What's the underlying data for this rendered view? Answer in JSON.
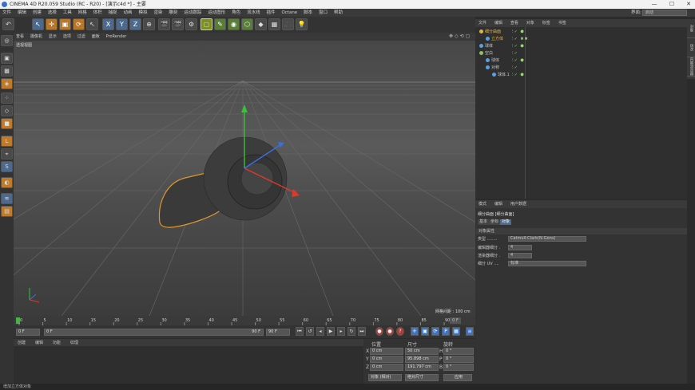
{
  "window": {
    "title": "CINEMA 4D R20.059 Studio (RC - R20) - [演示c4d *] - 主要",
    "min": "—",
    "max": "☐",
    "close": "✕"
  },
  "menubar": {
    "items": [
      "文件",
      "编辑",
      "创建",
      "选择",
      "工具",
      "网格",
      "体积",
      "捕捉",
      "动画",
      "模拟",
      "渲染",
      "雕刻",
      "运动跟踪",
      "运动图形",
      "角色",
      "流水线",
      "插件",
      "Octane",
      "脚本",
      "窗口",
      "帮助"
    ],
    "layout_label": "界面:",
    "layout_value": "启动"
  },
  "viewport": {
    "menu": [
      "查看",
      "摄像机",
      "显示",
      "选项",
      "过滤",
      "面板",
      "ProRender"
    ],
    "label": "透视视图",
    "controls": "✥◇⟲▢",
    "grid_info": "网格间距 : 100 cm"
  },
  "timeline": {
    "ticks": [
      "0",
      "5",
      "10",
      "15",
      "20",
      "25",
      "30",
      "35",
      "40",
      "45",
      "50",
      "55",
      "60",
      "65",
      "70",
      "75",
      "80",
      "85",
      "90"
    ],
    "end_frame": "0 F"
  },
  "transport": {
    "current": "0 F",
    "start": "0 F",
    "range_end": "90 F",
    "end": "90 F"
  },
  "materials": {
    "menu": [
      "创建",
      "编辑",
      "功能",
      "纹理"
    ]
  },
  "coordinates": {
    "headers": [
      "位置",
      "尺寸",
      "旋转"
    ],
    "rows": [
      {
        "axis": "X",
        "pos": "0 cm",
        "size": "50 cm",
        "rot_axis": "H",
        "rot": "0 °"
      },
      {
        "axis": "Y",
        "pos": "0 cm",
        "size": "95.898 cm",
        "rot_axis": "P",
        "rot": "0 °"
      },
      {
        "axis": "Z",
        "pos": "0 cm",
        "size": "191.797 cm",
        "rot_axis": "B",
        "rot": "0 °"
      }
    ],
    "mode1": "对象 (相对)",
    "mode2": "绝对尺寸",
    "apply": "应用"
  },
  "objects": {
    "menu": [
      "文件",
      "编辑",
      "查看",
      "对象",
      "标签",
      "书签"
    ],
    "tree": [
      {
        "label": "细分曲面",
        "indent": 0,
        "color": "#e0b24a"
      },
      {
        "label": "立方体",
        "indent": 1,
        "color": "#5ba0e0"
      },
      {
        "label": "球体",
        "indent": 0,
        "color": "#5ba0e0"
      },
      {
        "label": "空白",
        "indent": 0,
        "color": "#8fbf6a"
      },
      {
        "label": "球体",
        "indent": 1,
        "color": "#5ba0e0"
      },
      {
        "label": "对称",
        "indent": 1,
        "color": "#5ba0e0"
      },
      {
        "label": "球体.1",
        "indent": 2,
        "color": "#5ba0e0"
      }
    ],
    "side_tabs": [
      "对象",
      "场次",
      "内容浏览器"
    ]
  },
  "attributes": {
    "menu": [
      "模式",
      "编辑",
      "用户数据"
    ],
    "header": "细分曲面 [细分曲面]",
    "tabs": [
      "基本",
      "坐标",
      "对象"
    ],
    "section": "对象属性",
    "fields": [
      {
        "label": "类型 ........",
        "value": "Catmull-Clark(N-Gons)"
      },
      {
        "label": "编辑器细分 .",
        "value": "4"
      },
      {
        "label": "渲染器细分 .",
        "value": "4"
      },
      {
        "label": "细分 UV ....",
        "value": "标准"
      }
    ]
  },
  "status": {
    "text": "增加立方体对象"
  },
  "colors": {
    "accent": "#e0b24a",
    "axis_x": "#e0382b",
    "axis_y": "#3ac03a",
    "axis_z": "#3a6fe0"
  }
}
